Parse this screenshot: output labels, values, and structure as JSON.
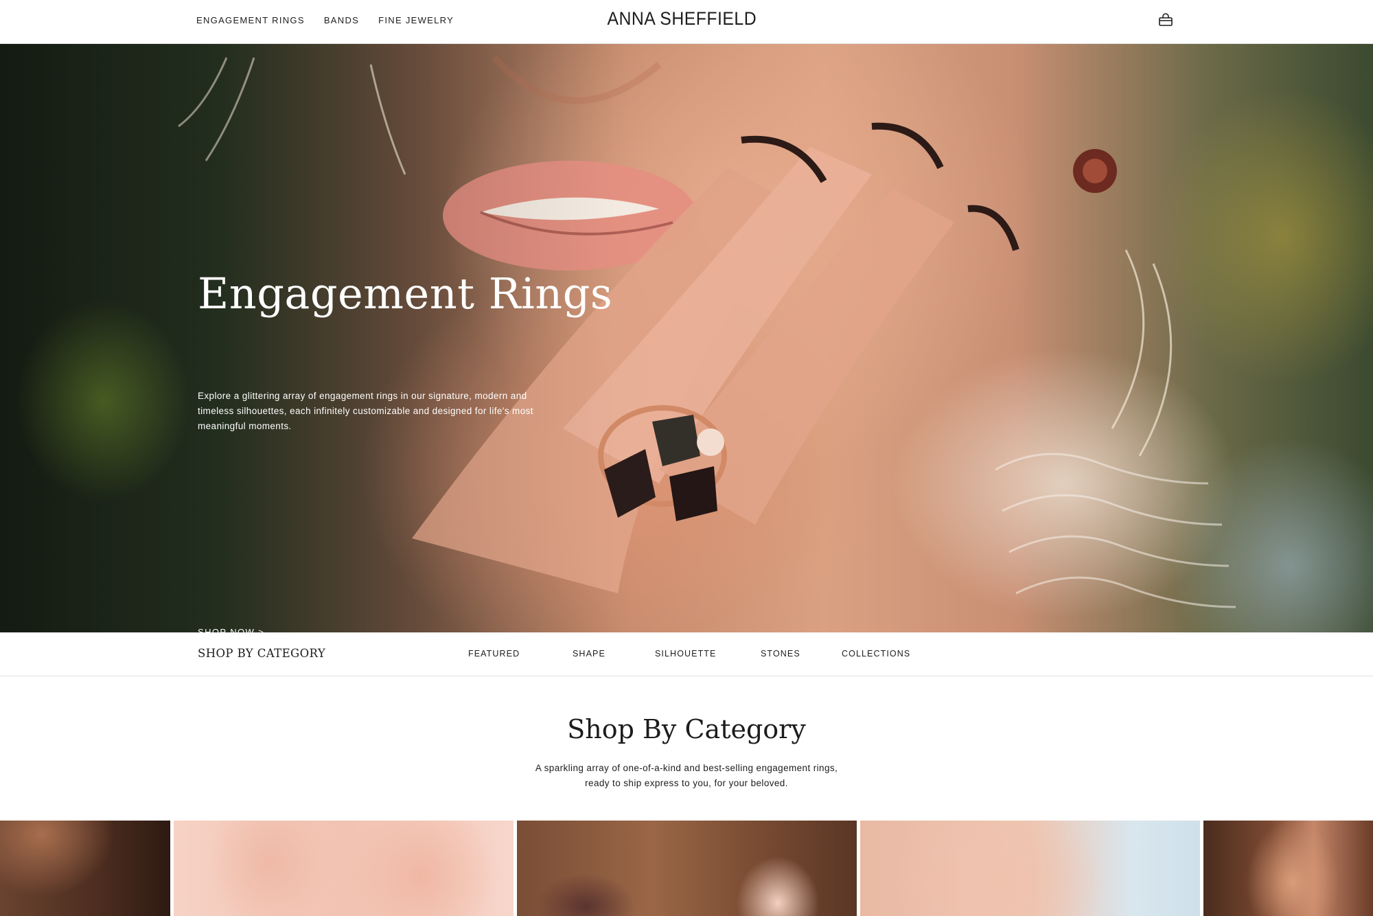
{
  "header": {
    "nav": [
      "ENGAGEMENT RINGS",
      "BANDS",
      "FINE JEWELRY"
    ],
    "brand": "ANNA SHEFFIELD",
    "cart_icon": "shopping-bag-icon"
  },
  "hero": {
    "title": "Engagement Rings",
    "description": "Explore a glittering array of engagement rings in our signature, modern and timeless silhouettes, each infinitely customizable and designed for life's most meaningful moments.",
    "cta": "SHOP NOW >"
  },
  "category_bar": {
    "title": "SHOP BY CATEGORY",
    "tabs": [
      "FEATURED",
      "SHAPE",
      "SILHOUETTE",
      "STONES",
      "COLLECTIONS"
    ]
  },
  "section": {
    "heading": "Shop By Category",
    "description": "A sparkling array of one-of-a-kind and best-selling engagement rings, ready to ship express to you, for your beloved."
  },
  "colors": {
    "text": "#1c1c1c",
    "background": "#ffffff",
    "divider": "#e2e2e2"
  }
}
